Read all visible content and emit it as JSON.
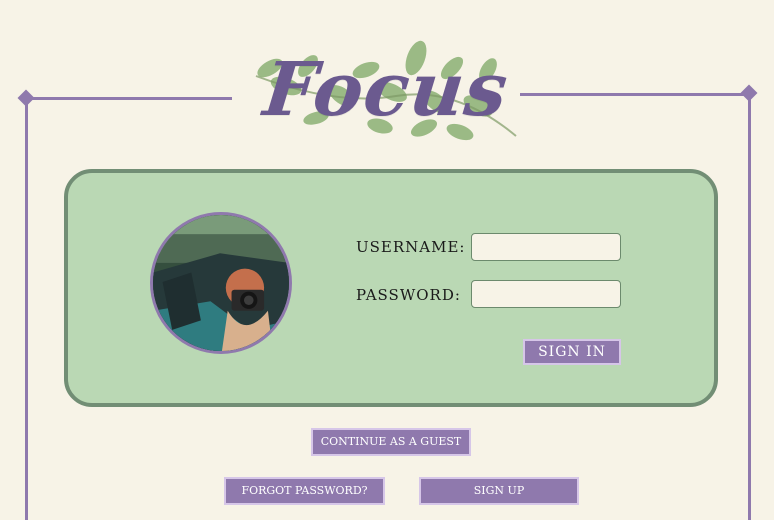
{
  "app": {
    "logo_text": "Focus"
  },
  "login": {
    "username_label": "USERNAME:",
    "password_label": "PASSWORD:",
    "username_value": "",
    "password_value": "",
    "sign_in_label": "SIGN IN"
  },
  "actions": {
    "guest_label": "CONTINUE AS A GUEST",
    "forgot_label": "FORGOT PASSWORD?",
    "signup_label": "SIGN UP"
  },
  "colors": {
    "background": "#f7f3e7",
    "accent": "#8f79ad",
    "card": "#bad8b4",
    "card_border": "#728e75",
    "logo": "#6b5a8f"
  },
  "icons": {
    "logo_leaves": "leaf-branch-icon",
    "profile_photo": "profile-photo"
  }
}
